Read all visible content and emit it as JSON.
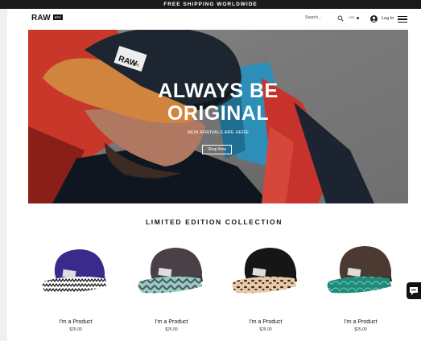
{
  "announcement": "FREE SHIPPING WORLDWIDE",
  "header": {
    "logo_main": "RAW",
    "logo_tag": "ETC",
    "search_placeholder": "Search...",
    "currency": "USD",
    "login_label": "Log In"
  },
  "hero": {
    "title_line1": "ALWAYS BE",
    "title_line2": "ORIGINAL",
    "subtitle": "NEW ARRIVALS ARE HERE",
    "cta": "Shop Now",
    "cap_badge_main": "RAW",
    "cap_badge_tag": "ETC"
  },
  "collection": {
    "title": "LIMITED EDITION COLLECTION",
    "products": [
      {
        "name": "I'm a Product",
        "price": "$25.00",
        "crown_color": "#3a2a8c",
        "brim_pattern": "zigzag-black-white"
      },
      {
        "name": "I'm a Product",
        "price": "$25.00",
        "crown_color": "#4a4148",
        "brim_pattern": "mint-purple"
      },
      {
        "name": "I'm a Product",
        "price": "$25.00",
        "crown_color": "#161616",
        "brim_pattern": "leopard"
      },
      {
        "name": "I'm a Product",
        "price": "$25.00",
        "crown_color": "#4a3a32",
        "brim_pattern": "teal-leaf"
      }
    ]
  },
  "icons": {
    "search": "search-icon",
    "user": "avatar-icon",
    "menu": "hamburger-menu-icon",
    "chat": "chat-icon"
  }
}
